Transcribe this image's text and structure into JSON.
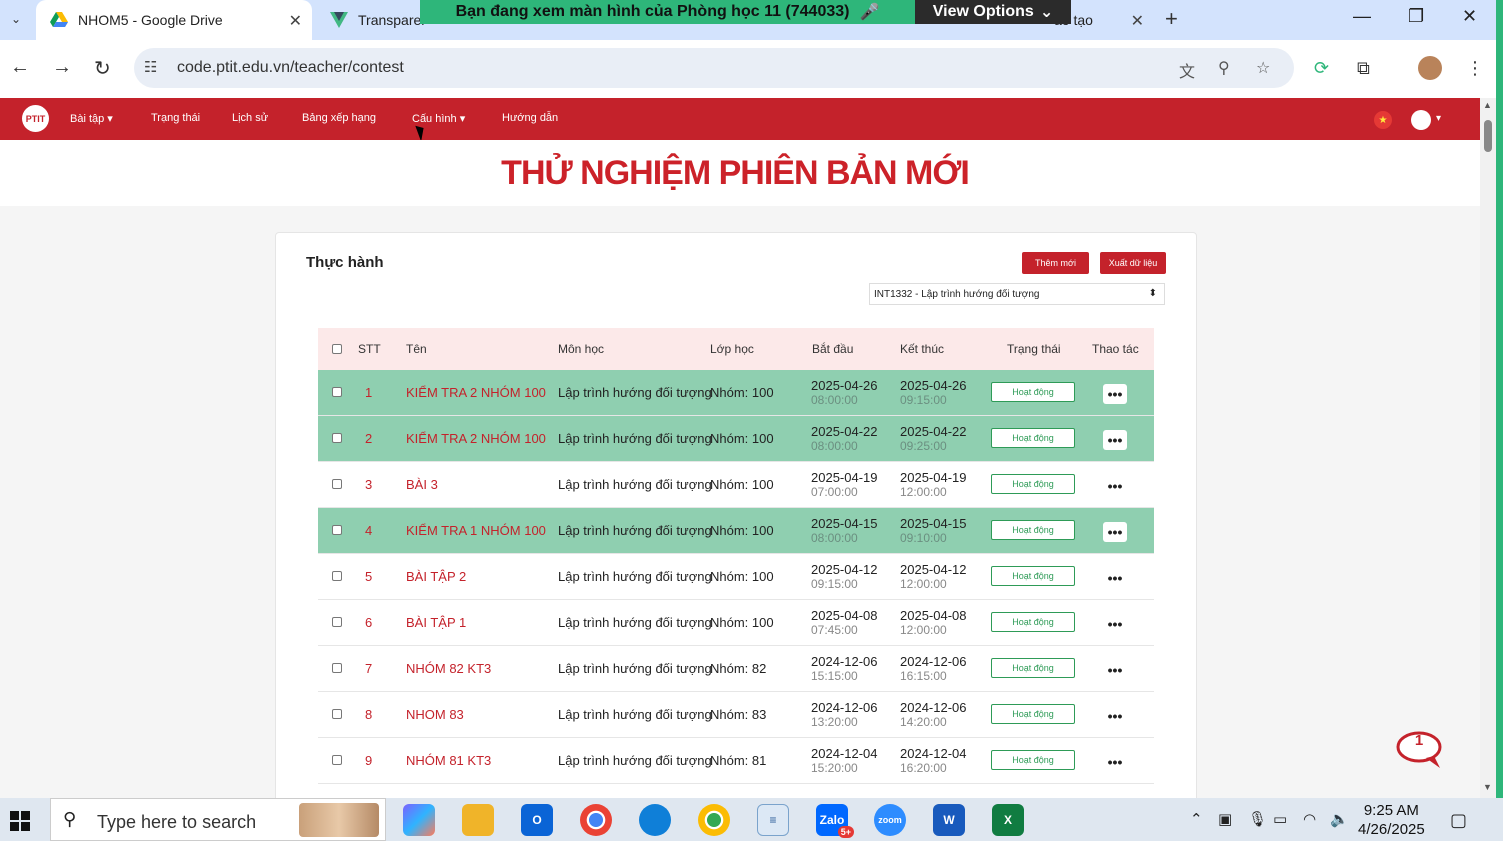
{
  "browser": {
    "tabs": [
      {
        "title": "NHOM5 - Google Drive",
        "icon": "google-drive-icon",
        "active": true
      },
      {
        "title": "Transparer",
        "icon": "vue-icon",
        "active": false
      },
      {
        "title": "ào tạo",
        "icon": "page-icon",
        "active": false
      }
    ],
    "url": "code.ptit.edu.vn/teacher/contest",
    "share_banner": "Bạn đang xem màn hình của  Phòng học 11 (744033)",
    "view_options": "View Options"
  },
  "site": {
    "logo_text": "PTIT",
    "nav": [
      "Bài tập",
      "Trạng thái",
      "Lịch sử",
      "Bảng xếp hạng",
      "Cấu hình",
      "Hướng dẫn"
    ],
    "banner_title": "THỬ NGHIỆM PHIÊN BẢN MỚI"
  },
  "card": {
    "title": "Thực hành",
    "add_button": "Thêm mới",
    "export_button": "Xuất dữ liệu",
    "course_select": "INT1332 - Lập trình hướng đối tượng"
  },
  "table": {
    "headers": [
      "STT",
      "Tên",
      "Môn học",
      "Lớp học",
      "Bắt đầu",
      "Kết thúc",
      "Trạng thái",
      "Thao tác"
    ],
    "rows": [
      {
        "stt": "1",
        "name": "KIỂM TRA 2 NHÓM 100",
        "subject": "Lập trình hướng đối tượng",
        "cls": "Nhóm: 100",
        "start_date": "2025-04-26",
        "start_time": "08:00:00",
        "end_date": "2025-04-26",
        "end_time": "09:15:00",
        "status": "Hoạt động",
        "highlight": true
      },
      {
        "stt": "2",
        "name": "KIỂM TRA 2 NHÓM 100",
        "subject": "Lập trình hướng đối tượng",
        "cls": "Nhóm: 100",
        "start_date": "2025-04-22",
        "start_time": "08:00:00",
        "end_date": "2025-04-22",
        "end_time": "09:25:00",
        "status": "Hoạt động",
        "highlight": true
      },
      {
        "stt": "3",
        "name": "BÀI 3",
        "subject": "Lập trình hướng đối tượng",
        "cls": "Nhóm: 100",
        "start_date": "2025-04-19",
        "start_time": "07:00:00",
        "end_date": "2025-04-19",
        "end_time": "12:00:00",
        "status": "Hoạt động",
        "highlight": false
      },
      {
        "stt": "4",
        "name": "KIỂM TRA 1 NHÓM 100",
        "subject": "Lập trình hướng đối tượng",
        "cls": "Nhóm: 100",
        "start_date": "2025-04-15",
        "start_time": "08:00:00",
        "end_date": "2025-04-15",
        "end_time": "09:10:00",
        "status": "Hoạt động",
        "highlight": true
      },
      {
        "stt": "5",
        "name": "BÀI TẬP 2",
        "subject": "Lập trình hướng đối tượng",
        "cls": "Nhóm: 100",
        "start_date": "2025-04-12",
        "start_time": "09:15:00",
        "end_date": "2025-04-12",
        "end_time": "12:00:00",
        "status": "Hoạt động",
        "highlight": false
      },
      {
        "stt": "6",
        "name": "BÀI TẬP 1",
        "subject": "Lập trình hướng đối tượng",
        "cls": "Nhóm: 100",
        "start_date": "2025-04-08",
        "start_time": "07:45:00",
        "end_date": "2025-04-08",
        "end_time": "12:00:00",
        "status": "Hoạt động",
        "highlight": false
      },
      {
        "stt": "7",
        "name": "NHÓM 82 KT3",
        "subject": "Lập trình hướng đối tượng",
        "cls": "Nhóm: 82",
        "start_date": "2024-12-06",
        "start_time": "15:15:00",
        "end_date": "2024-12-06",
        "end_time": "16:15:00",
        "status": "Hoạt động",
        "highlight": false
      },
      {
        "stt": "8",
        "name": "NHOM 83",
        "subject": "Lập trình hướng đối tượng",
        "cls": "Nhóm: 83",
        "start_date": "2024-12-06",
        "start_time": "13:20:00",
        "end_date": "2024-12-06",
        "end_time": "14:20:00",
        "status": "Hoạt động",
        "highlight": false
      },
      {
        "stt": "9",
        "name": "NHÓM 81 KT3",
        "subject": "Lập trình hướng đối tượng",
        "cls": "Nhóm: 81",
        "start_date": "2024-12-04",
        "start_time": "15:20:00",
        "end_date": "2024-12-04",
        "end_time": "16:20:00",
        "status": "Hoạt động",
        "highlight": false
      }
    ]
  },
  "chat": {
    "count": "1"
  },
  "taskbar": {
    "search_placeholder": "Type here to search",
    "zalo_badge": "5+",
    "time": "9:25 AM",
    "date": "4/26/2025"
  },
  "colors": {
    "brand_red": "#c4222b",
    "highlight_green": "#8fcfb0",
    "status_green": "#2e9b57"
  }
}
